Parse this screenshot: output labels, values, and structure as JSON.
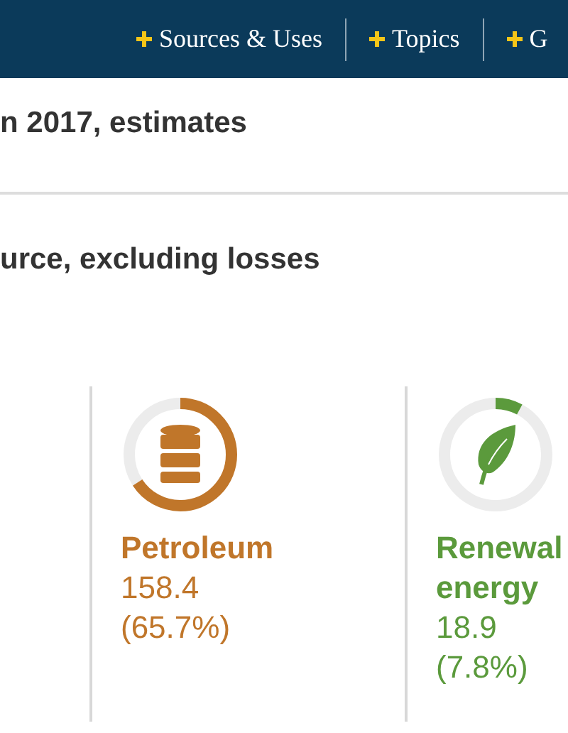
{
  "nav": {
    "items": [
      {
        "label": "Sources & Uses"
      },
      {
        "label": "Topics"
      },
      {
        "label": "G"
      }
    ]
  },
  "subtitle": "n 2017, estimates",
  "section_title": "urce, excluding losses",
  "sources": [
    {
      "name": "Petroleum",
      "value": "158.4",
      "share": "(65.7%)",
      "color": "#c0762a",
      "kind": "barrel"
    },
    {
      "name": "Renewal energy",
      "value": "18.9",
      "share": "(7.8%)",
      "color": "#5b9a3c",
      "kind": "leaf"
    }
  ]
}
